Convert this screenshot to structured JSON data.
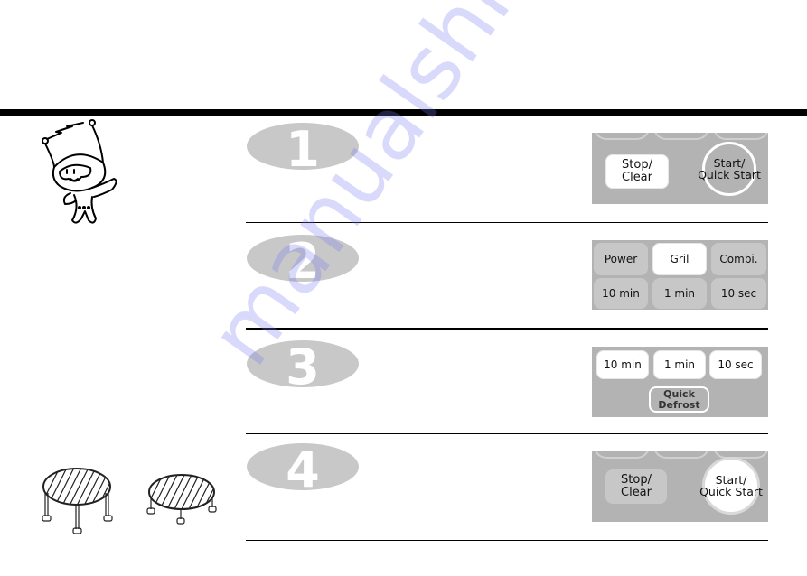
{
  "steps": [
    {
      "number": "1",
      "panel": {
        "keys": [
          {
            "label": "Stop/ Clear",
            "line1": "Stop/",
            "line2": "Clear",
            "style": "white"
          },
          {
            "label": "Start/ Quick Start",
            "line1": "Start/",
            "line2": "Quick Start",
            "style": "ring"
          }
        ]
      }
    },
    {
      "number": "2",
      "panel": {
        "keys": [
          {
            "label": "Power",
            "style": "light"
          },
          {
            "label": "Gril",
            "style": "white"
          },
          {
            "label": "Combi.",
            "style": "light"
          },
          {
            "label": "10 min",
            "style": "light"
          },
          {
            "label": "1 min",
            "style": "light"
          },
          {
            "label": "10 sec",
            "style": "light"
          }
        ]
      }
    },
    {
      "number": "3",
      "panel": {
        "keys": [
          {
            "label": "10 min",
            "style": "white"
          },
          {
            "label": "1 min",
            "style": "white"
          },
          {
            "label": "10 sec",
            "style": "white"
          },
          {
            "label": "Quick Defrost",
            "line1": "Quick",
            "line2": "Defrost",
            "style": "outlined"
          }
        ]
      }
    },
    {
      "number": "4",
      "panel": {
        "keys": [
          {
            "label": "Stop/ Clear",
            "line1": "Stop/",
            "line2": "Clear",
            "style": "light"
          },
          {
            "label": "Start/ Quick Start",
            "line1": "Start/",
            "line2": "Quick Start",
            "style": "ringfill"
          }
        ]
      }
    }
  ],
  "illustrations": {
    "mascot": "cartoon-alien-mascot",
    "racks": [
      "high-rack",
      "low-rack"
    ]
  },
  "watermark": "manualshive.com",
  "colors": {
    "panel_gray": "#b3b3b3",
    "badge_gray": "#c8c8c8",
    "rule": "#000000",
    "watermark": "#7878f0"
  }
}
